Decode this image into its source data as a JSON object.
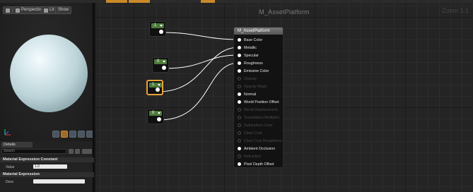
{
  "viewport": {
    "buttons": [
      {
        "name": "viewport-menu-button",
        "label": ""
      },
      {
        "name": "perspective-button",
        "label": "Perspective"
      },
      {
        "name": "lit-button",
        "label": "Lit"
      },
      {
        "name": "show-button",
        "label": "Show"
      }
    ]
  },
  "details": {
    "tab_label": "Details",
    "search_placeholder": "Search",
    "section1": "Material Expression Constant",
    "value_label": "Value",
    "value": "1.0",
    "section2": "Material Expression",
    "desc_label": "Desc"
  },
  "graph": {
    "title": "M_AssetPlatform",
    "zoom": "Zoom 1:1"
  },
  "constants": [
    {
      "value": "1",
      "selected": false
    },
    {
      "value": "0",
      "selected": false
    },
    {
      "value": "1",
      "selected": true
    },
    {
      "value": "0",
      "selected": false
    }
  ],
  "material_node": {
    "title": "M_AssetPlatform",
    "pins": [
      {
        "label": "Base Color",
        "enabled": true
      },
      {
        "label": "Metallic",
        "enabled": true
      },
      {
        "label": "Specular",
        "enabled": true
      },
      {
        "label": "Roughness",
        "enabled": true
      },
      {
        "label": "Emissive Color",
        "enabled": true
      },
      {
        "label": "Opacity",
        "enabled": false
      },
      {
        "label": "Opacity Mask",
        "enabled": false
      },
      {
        "label": "Normal",
        "enabled": true
      },
      {
        "label": "World Position Offset",
        "enabled": true
      },
      {
        "label": "World Displacement",
        "enabled": false
      },
      {
        "label": "Tessellation Multiplier",
        "enabled": false
      },
      {
        "label": "Subsurface Color",
        "enabled": false
      },
      {
        "label": "Clear Coat",
        "enabled": false
      },
      {
        "label": "Clear Coat Roughness",
        "enabled": false
      },
      {
        "label": "Ambient Occlusion",
        "enabled": true
      },
      {
        "label": "Refraction",
        "enabled": false
      },
      {
        "label": "Pixel Depth Offset",
        "enabled": true
      }
    ]
  },
  "colors": {
    "constant_header": "#4d7a3b",
    "selected_outline": "#e7a23a",
    "wire": "#ffffff"
  }
}
